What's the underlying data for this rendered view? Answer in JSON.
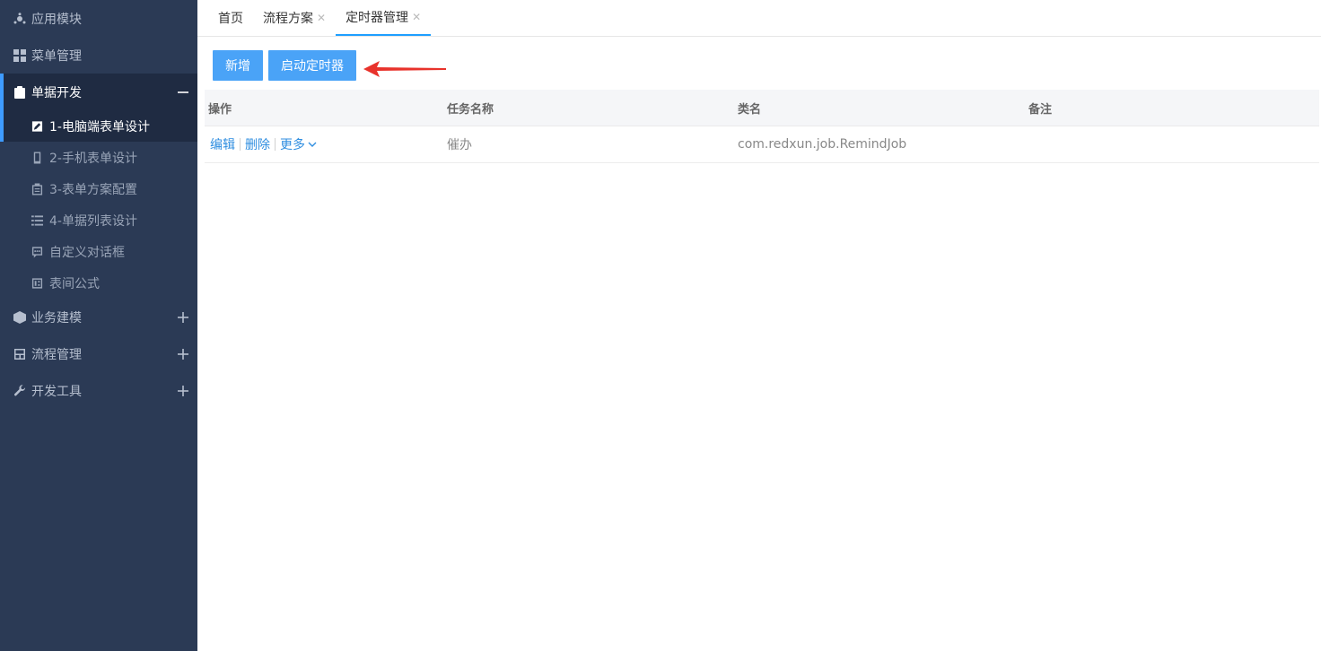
{
  "sidebar": {
    "items": [
      {
        "label": "应用模块",
        "icon": "app-module-icon"
      },
      {
        "label": "菜单管理",
        "icon": "grid-icon"
      },
      {
        "label": "单据开发",
        "icon": "clipboard-icon",
        "expanded": true
      },
      {
        "label": "业务建模",
        "icon": "cube-icon"
      },
      {
        "label": "流程管理",
        "icon": "flow-icon"
      },
      {
        "label": "开发工具",
        "icon": "wrench-icon"
      }
    ],
    "sub_items": [
      {
        "label": "1-电脑端表单设计",
        "icon": "edit-icon",
        "active": true
      },
      {
        "label": "2-手机表单设计",
        "icon": "mobile-icon"
      },
      {
        "label": "3-表单方案配置",
        "icon": "clipboard-list-icon"
      },
      {
        "label": "4-单据列表设计",
        "icon": "list-icon"
      },
      {
        "label": "自定义对话框",
        "icon": "dialog-icon"
      },
      {
        "label": "表间公式",
        "icon": "formula-icon"
      }
    ]
  },
  "tabs": [
    {
      "label": "首页",
      "closable": false
    },
    {
      "label": "流程方案",
      "closable": true
    },
    {
      "label": "定时器管理",
      "closable": true,
      "active": true
    }
  ],
  "toolbar": {
    "add_label": "新增",
    "start_timer_label": "启动定时器"
  },
  "table": {
    "headers": [
      "操作",
      "任务名称",
      "类名",
      "备注"
    ],
    "rows": [
      {
        "task_name": "催办",
        "class_name": "com.redxun.job.RemindJob",
        "remark": ""
      }
    ],
    "row_actions": {
      "edit": "编辑",
      "delete": "删除",
      "more": "更多"
    }
  },
  "colors": {
    "sidebar_bg": "#2b3a55",
    "accent": "#4aa3f7",
    "link": "#2f8ee0",
    "arrow": "#e8322b"
  }
}
